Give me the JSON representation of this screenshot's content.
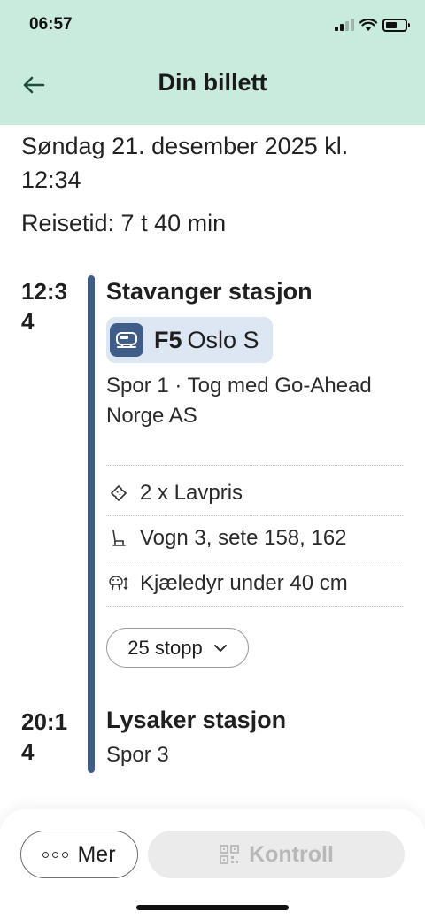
{
  "status_bar": {
    "time": "06:57"
  },
  "header": {
    "title": "Din billett",
    "back_icon": "arrow-left-icon"
  },
  "trip": {
    "date_line": "Søndag 21. desember 2025 kl. 12:34",
    "travel_time": "Reisetid: 7 t 40 min"
  },
  "departure": {
    "time": "12:34",
    "station": "Stavanger stasjon",
    "line_code": "F5",
    "line_destination": "Oslo S",
    "track_operator": "Spor 1 · Tog med Go-Ahead Norge AS",
    "details": [
      {
        "icon": "ticket-icon",
        "label": "2 x Lavpris"
      },
      {
        "icon": "seat-icon",
        "label": "Vogn 3, sete 158, 162"
      },
      {
        "icon": "pet-icon",
        "label": "Kjæledyr under 40 cm"
      }
    ],
    "stops_label": "25 stopp"
  },
  "arrival": {
    "time": "20:14",
    "station": "Lysaker stasjon",
    "track": "Spor 3"
  },
  "actions": {
    "more_label": "Mer",
    "kontroll_label": "Kontroll"
  },
  "colors": {
    "header_bg": "#c8ebdd",
    "timeline": "#3f5d88",
    "chip_bg": "#dde6f3"
  }
}
